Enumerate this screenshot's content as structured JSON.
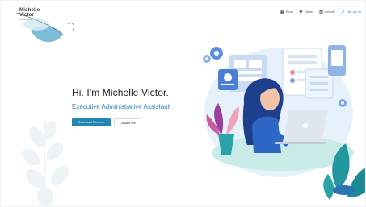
{
  "brand": {
    "line1": "Michelle",
    "line2": "Victor"
  },
  "nav": {
    "items": [
      {
        "label": "Email",
        "icon": "email-icon"
      },
      {
        "label": "Twitter",
        "icon": "twitter-icon"
      },
      {
        "label": "LinkedIn",
        "icon": "linkedin-icon"
      },
      {
        "label": "Hire my VA",
        "icon": "edit-icon",
        "accent": true
      }
    ]
  },
  "hero": {
    "title": "Hi. I'm Michelle Victor.",
    "subtitle": "Executive Administrative Assistant",
    "primary_button": "Download Resume",
    "secondary_button": "Contact Me"
  },
  "colors": {
    "accent": "#2186b0",
    "subtitle": "#2586b7",
    "teal": "#2aa3a8",
    "light_teal": "#bfe3e5",
    "illustration_blue": "#3b6fd6"
  }
}
